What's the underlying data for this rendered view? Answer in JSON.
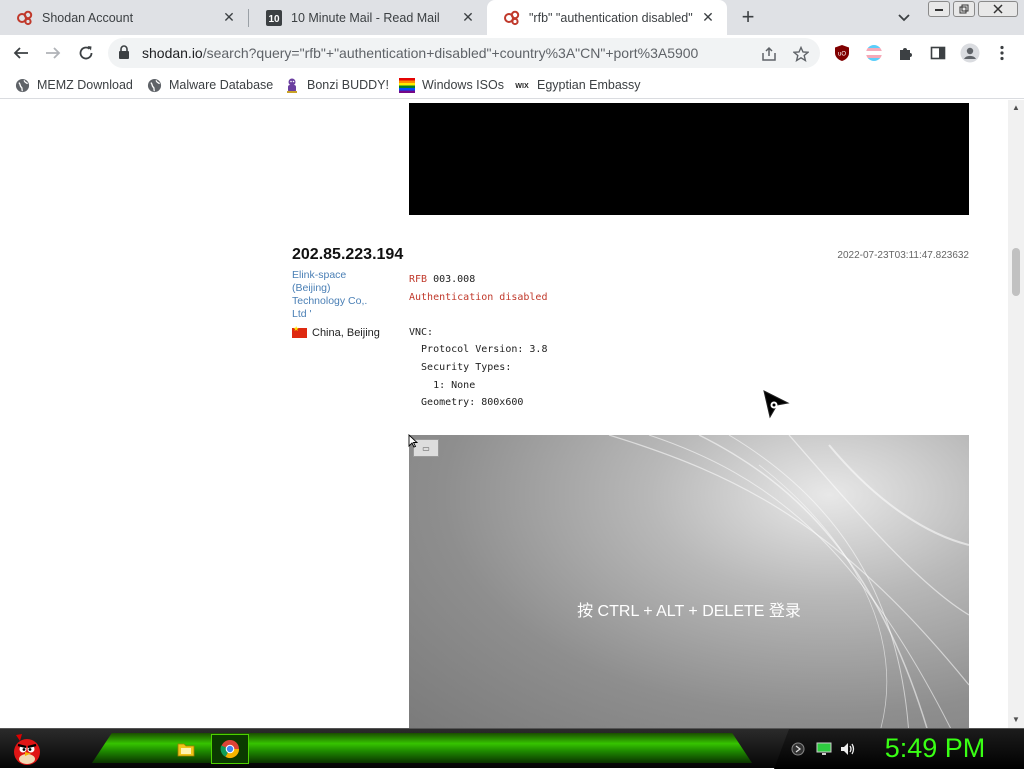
{
  "browser": {
    "tabs": [
      {
        "title": "Shodan Account",
        "icon": "shodan-icon",
        "active": false
      },
      {
        "title": "10 Minute Mail - Read Mail",
        "icon": "10minutemail-icon",
        "active": false
      },
      {
        "title": "\"rfb\" \"authentication disabled\" co",
        "icon": "shodan-icon",
        "active": true
      }
    ],
    "new_tab_label": "+",
    "url_host": "shodan.io",
    "url_path": "/search?query=\"rfb\"+\"authentication+disabled\"+country%3A\"CN\"+port%3A5900",
    "extensions": [
      "ublock-icon",
      "trans-flag-icon",
      "puzzle-icon",
      "sidepanel-icon",
      "profile-icon",
      "menu-icon"
    ]
  },
  "bookmarks": [
    {
      "label": "MEMZ Download",
      "icon": "globe-icon"
    },
    {
      "label": "Malware Database",
      "icon": "globe-icon"
    },
    {
      "label": "Bonzi BUDDY!",
      "icon": "bonzi-icon"
    },
    {
      "label": "Windows ISOs",
      "icon": "windows-icon"
    },
    {
      "label": "Egyptian Embassy",
      "icon": "wix-icon"
    }
  ],
  "result": {
    "ip": "202.85.223.194",
    "timestamp": "2022-07-23T03:11:47.823632",
    "org": "Elink-space (Beijing) Technology Co,. Ltd '",
    "location": "China, Beijing",
    "banner_line1_prefix": "RFB",
    "banner_line1_value": " 003.008",
    "banner_auth": "Authentication disabled",
    "banner_body": "VNC:\n  Protocol Version: 3.8\n  Security Types:\n    1: None\n  Geometry: 800x600",
    "screenshot_message": "按 CTRL + ALT + DELETE 登录"
  },
  "taskbar": {
    "clock": "5:49 PM",
    "apps": [
      "folder-icon",
      "chrome-icon"
    ],
    "tray": [
      "network-icon",
      "monitor-icon",
      "volume-icon"
    ],
    "accent": "#39ff14"
  }
}
